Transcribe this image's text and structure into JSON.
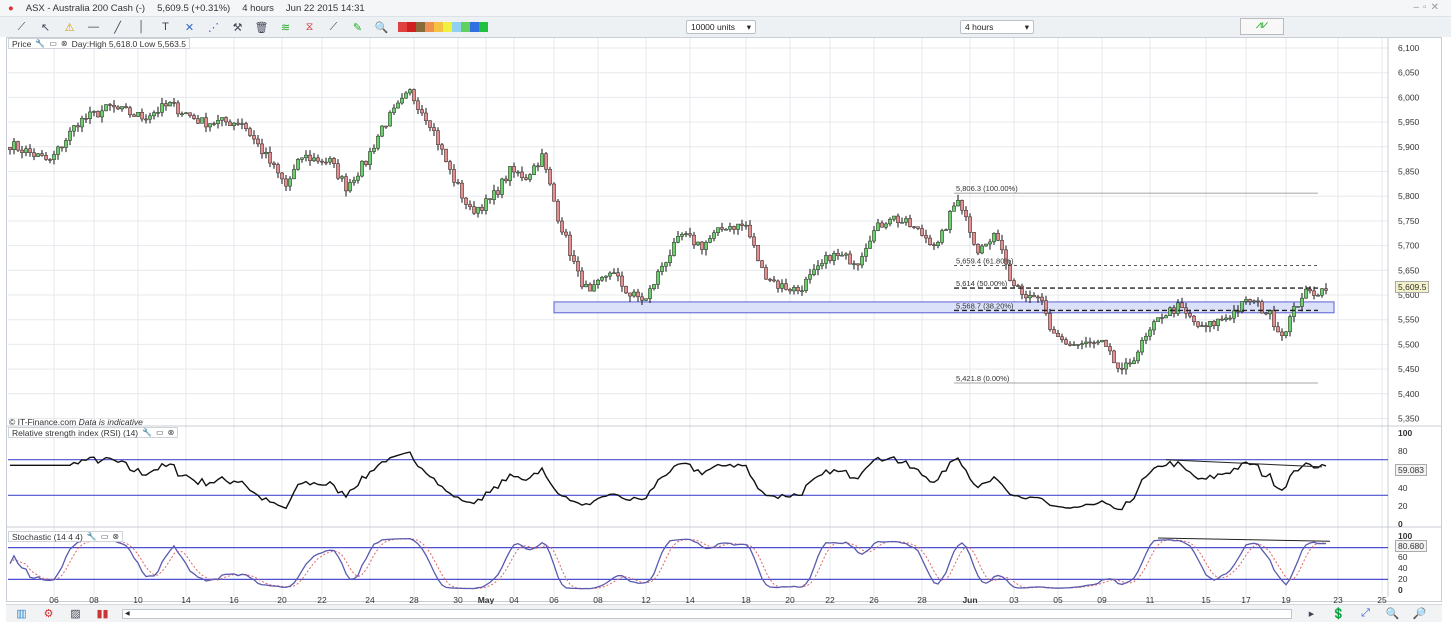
{
  "titlebar": {
    "instrument": "ASX - Australia 200 Cash (-)",
    "quote": "5,609.5 (+0.31%)",
    "interval": "4 hours",
    "datetime": "Jun 22 2015 14:31"
  },
  "toolbar": {
    "icons": [
      "ruler-icon",
      "pointer-icon",
      "alert-icon",
      "horizontal-line-icon",
      "trend-line-icon",
      "vertical-line-icon",
      "text-icon",
      "cross-icon",
      "fan-icon",
      "tools-icon",
      "trash-icon",
      "fibonacci-icon",
      "channel-icon",
      "line-icon",
      "chart-edit-icon",
      "zoom-icon"
    ],
    "colors": [
      "#e04040",
      "#d02020",
      "#8a6a3a",
      "#f09050",
      "#f6c040",
      "#f0f040",
      "#90d0f0",
      "#60d060",
      "#3070e0",
      "#20c040"
    ],
    "units_select": "10000 units",
    "interval_select": "4 hours"
  },
  "price_panel": {
    "label": "Price",
    "day_info": "Day:High 5,618.0 Low 5,563.5",
    "copyright": "© IT-Finance.com",
    "disclaimer": "Data is indicative",
    "current_price": "5,609.5"
  },
  "rsi_panel": {
    "label": "Relative strength index (RSI) (14)",
    "current": "59.083",
    "ticks": [
      "100",
      "80",
      "40",
      "20",
      "0"
    ]
  },
  "stoch_panel": {
    "label": "Stochastic (14 4 4)",
    "current": "80.680",
    "ticks": [
      "100",
      "60",
      "40",
      "20",
      "0"
    ]
  },
  "chart_data": {
    "type": "candlestick",
    "title": "ASX - Australia 200 Cash, 4 hours",
    "price_ticks": [
      6100,
      6050,
      6000,
      5950,
      5900,
      5850,
      5800,
      5750,
      5700,
      5650,
      5600,
      5550,
      5500,
      5450,
      5400,
      5350
    ],
    "price_range": [
      5350,
      6120
    ],
    "close_path": [
      [
        0,
        5905
      ],
      [
        10,
        5870
      ],
      [
        17,
        5950
      ],
      [
        25,
        5980
      ],
      [
        33,
        5960
      ],
      [
        40,
        5985
      ],
      [
        48,
        5950
      ],
      [
        58,
        5950
      ],
      [
        64,
        5880
      ],
      [
        69,
        5820
      ],
      [
        73,
        5880
      ],
      [
        80,
        5870
      ],
      [
        84,
        5820
      ],
      [
        89,
        5870
      ],
      [
        93,
        5940
      ],
      [
        100,
        6010
      ],
      [
        105,
        5950
      ],
      [
        110,
        5850
      ],
      [
        115,
        5770
      ],
      [
        120,
        5790
      ],
      [
        125,
        5850
      ],
      [
        129,
        5840
      ],
      [
        133,
        5880
      ],
      [
        137,
        5760
      ],
      [
        142,
        5640
      ],
      [
        145,
        5600
      ],
      [
        150,
        5650
      ],
      [
        155,
        5600
      ],
      [
        159,
        5590
      ],
      [
        163,
        5660
      ],
      [
        168,
        5720
      ],
      [
        173,
        5700
      ],
      [
        179,
        5740
      ],
      [
        184,
        5740
      ],
      [
        188,
        5650
      ],
      [
        192,
        5620
      ],
      [
        197,
        5610
      ],
      [
        202,
        5650
      ],
      [
        205,
        5680
      ],
      [
        212,
        5670
      ],
      [
        215,
        5720
      ],
      [
        220,
        5760
      ],
      [
        225,
        5740
      ],
      [
        232,
        5700
      ],
      [
        237,
        5800
      ],
      [
        242,
        5690
      ],
      [
        247,
        5720
      ],
      [
        250,
        5640
      ],
      [
        255,
        5590
      ],
      [
        258,
        5590
      ],
      [
        260,
        5520
      ],
      [
        265,
        5500
      ],
      [
        273,
        5500
      ],
      [
        278,
        5440
      ],
      [
        283,
        5500
      ],
      [
        288,
        5560
      ],
      [
        292,
        5575
      ],
      [
        298,
        5530
      ],
      [
        305,
        5560
      ],
      [
        310,
        5590
      ],
      [
        315,
        5560
      ],
      [
        318,
        5520
      ],
      [
        323,
        5600
      ],
      [
        328,
        5610
      ],
      [
        329,
        5609.5
      ]
    ],
    "x_labels": [
      [
        "06",
        11
      ],
      [
        "08",
        21
      ],
      [
        "10",
        32
      ],
      [
        "14",
        44
      ],
      [
        "16",
        56
      ],
      [
        "20",
        68
      ],
      [
        "22",
        78
      ],
      [
        "24",
        90
      ],
      [
        "28",
        101
      ],
      [
        "30",
        112
      ],
      [
        "May",
        119
      ],
      [
        "04",
        126
      ],
      [
        "06",
        136
      ],
      [
        "08",
        147
      ],
      [
        "12",
        159
      ],
      [
        "14",
        170
      ],
      [
        "18",
        184
      ],
      [
        "20",
        195
      ],
      [
        "22",
        205
      ],
      [
        "26",
        216
      ],
      [
        "28",
        228
      ],
      [
        "Jun",
        240
      ],
      [
        "03",
        251
      ],
      [
        "05",
        262
      ],
      [
        "09",
        273
      ],
      [
        "11",
        285
      ],
      [
        "15",
        299
      ],
      [
        "17",
        309
      ],
      [
        "19",
        319
      ],
      [
        "23",
        332
      ],
      [
        "25",
        343
      ]
    ],
    "support_zone": {
      "from_bar": 136,
      "to_bar": 331,
      "low": 5564,
      "high": 5586
    },
    "fibonacci": {
      "from_bar": 236,
      "to_bar": 327,
      "levels": [
        {
          "label": "5,806.3 (100.00%)",
          "price": 5806.3,
          "style": "solid"
        },
        {
          "label": "5,659.4 (61.80%)",
          "price": 5659.4,
          "style": "thin-dash"
        },
        {
          "label": "5,614 (50.00%)",
          "price": 5614,
          "style": "dash"
        },
        {
          "label": "5,568.7 (38.20%)",
          "price": 5568.7,
          "style": "dash"
        },
        {
          "label": "5,421.8 (0.00%)",
          "price": 5421.8,
          "style": "solid"
        }
      ]
    },
    "rsi": {
      "period": 14,
      "bands": [
        70,
        30
      ],
      "trendline": [
        [
          289,
          70
        ],
        [
          328,
          62
        ]
      ]
    },
    "stochastic": {
      "params": [
        14,
        4,
        4
      ],
      "bands": [
        80,
        20
      ],
      "trendline": [
        [
          287,
          98
        ],
        [
          330,
          92
        ]
      ]
    },
    "colors": {
      "up": "#6fcf6f",
      "down": "#e39090",
      "band": "#4b4fd0",
      "zone_fill": "#d7def8"
    }
  },
  "bottombar": {
    "icons": [
      "chart-type-icon",
      "indicators-icon",
      "drawing-icon",
      "compare-icon"
    ],
    "zoom_icons": [
      "money-icon",
      "fit-icon",
      "zoom-out-icon",
      "zoom-in-icon"
    ]
  }
}
